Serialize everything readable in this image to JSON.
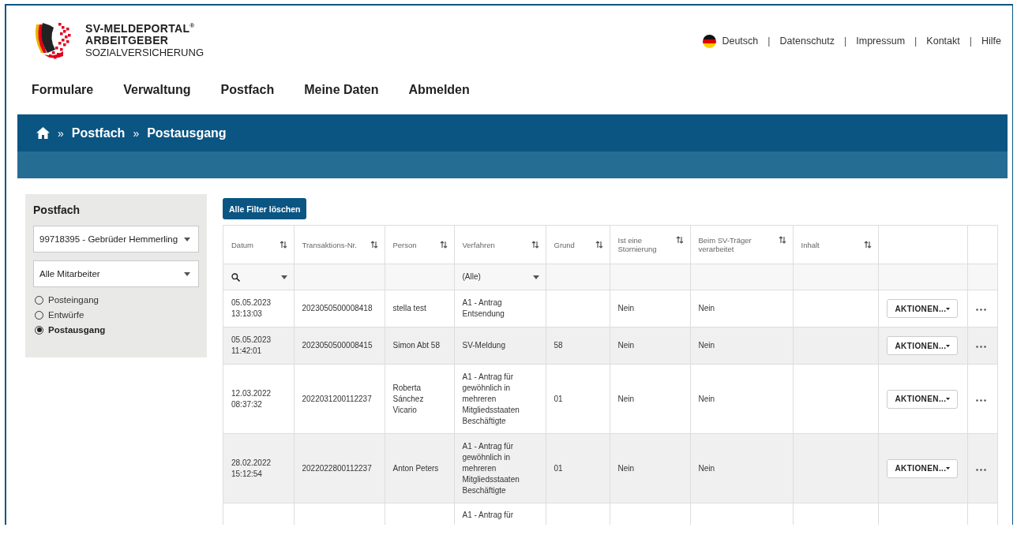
{
  "logo": {
    "line_1": "SV-MELDEPORTAL$^{®}$",
    "line_2": "ARBEITGEBER",
    "line_3": "SOZIALVERSICHERUNG"
  },
  "top_links": [
    {
      "label": "Deutsch",
      "kind": "language"
    },
    {
      "label": "Datenschutz",
      "kind": "link"
    },
    {
      "label": "Impressum",
      "kind": "link"
    },
    {
      "label": "Kontakt",
      "kind": "link"
    },
    {
      "label": "Hilfe",
      "kind": "link"
    }
  ],
  "top_link_separator": "|",
  "nav": [
    "Formulare",
    "Verwaltung",
    "Postfach",
    "Meine Daten",
    "Abmelden"
  ],
  "breadcrumb": {
    "separator": "»",
    "items": [
      "Postfach",
      "Postausgang"
    ]
  },
  "sidebar": {
    "title": "Postfach",
    "account_select": "99718395 - Gebrüder Hemmerling",
    "employee_select": "Alle Mitarbeiter",
    "options": [
      {
        "label": "Posteingang",
        "selected": false
      },
      {
        "label": "Entwürfe",
        "selected": false
      },
      {
        "label": "Postausgang",
        "selected": true
      }
    ]
  },
  "clear_filters_button": "Alle Filter löschen",
  "table": {
    "columns": [
      {
        "label": "Datum",
        "sortable": true
      },
      {
        "label": "Transaktions-Nr.",
        "sortable": true
      },
      {
        "label": "Person",
        "sortable": true
      },
      {
        "label": "Verfahren",
        "sortable": true
      },
      {
        "label": "Grund",
        "sortable": true
      },
      {
        "label": "Ist eine Stornierung",
        "sortable": true
      },
      {
        "label": "Beim SV-Träger verarbeitet",
        "sortable": true
      },
      {
        "label": "Inhalt",
        "sortable": true
      },
      {
        "sortable": false
      },
      {
        "sortable": false
      }
    ],
    "filter_verfahren": "(Alle)",
    "rows": [
      {
        "datum": "05.05.2023\n13:13:03",
        "transaktion": "2023050500008418",
        "person": "stella test",
        "verfahren": "A1 - Antrag\nEntsendung",
        "storno": "Nein",
        "verarbeitet": "Nein",
        "action": "AKTIONEN..."
      },
      {
        "datum": "05.05.2023\n11:42:01",
        "transaktion": "2023050500008415",
        "person": "Simon Abt 58",
        "verfahren": "SV-Meldung",
        "grund": "58",
        "storno": "Nein",
        "verarbeitet": "Nein",
        "action": "AKTIONEN..."
      },
      {
        "datum": "12.03.2022\n08:37:32",
        "transaktion": "2022031200112237",
        "person": "Roberta\nSánchez\nVicario",
        "verfahren": "A1 - Antrag für\ngewöhnlich in\nmehreren\nMitgliedsstaaten\nBeschäftigte",
        "grund": "01",
        "storno": "Nein",
        "verarbeitet": "Nein",
        "action": "AKTIONEN..."
      },
      {
        "datum": "28.02.2022\n15:12:54",
        "transaktion": "2022022800112237",
        "person": "Anton Peters",
        "verfahren": "A1 - Antrag für\ngewöhnlich in\nmehreren\nMitgliedsstaaten\nBeschäftigte",
        "grund": "01",
        "storno": "Nein",
        "verarbeitet": "Nein",
        "action": "AKTIONEN..."
      },
      {
        "verfahren": "A1 - Antrag für"
      }
    ]
  }
}
